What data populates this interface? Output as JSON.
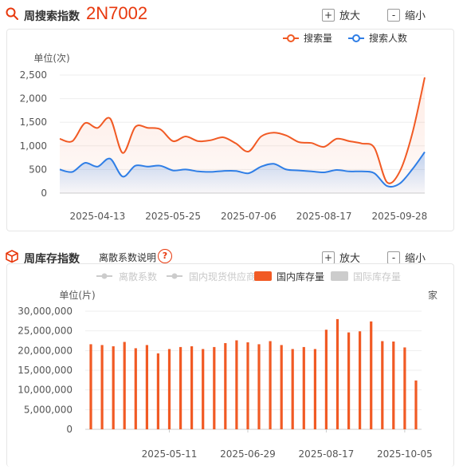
{
  "search_index": {
    "title": "周搜索指数",
    "part_code": "2N7002",
    "zoom_in_label": "放大",
    "zoom_out_label": "缩小",
    "colors": {
      "search_volume": "#f15a24",
      "searchers": "#2f7ee6"
    }
  },
  "inventory_index": {
    "title": "周库存指数",
    "explain_label": "离散系数说明",
    "help_symbol": "?",
    "zoom_in_label": "放大",
    "zoom_out_label": "缩小",
    "colors": {
      "domestic_inventory": "#f15a24",
      "inactive": "#cccccc"
    }
  },
  "chart_data": [
    {
      "type": "area",
      "ylabel": "单位(次)",
      "legend_position": "top-right",
      "ylim": [
        0,
        2500
      ],
      "yticks": [
        "0",
        "500",
        "1,000",
        "1,500",
        "2,000",
        "2,500"
      ],
      "xtick_labels": [
        "2025-04-13",
        "2025-05-25",
        "2025-07-06",
        "2025-08-17",
        "2025-09-28"
      ],
      "x": [
        "2025-03-23",
        "2025-03-30",
        "2025-04-06",
        "2025-04-13",
        "2025-04-20",
        "2025-04-27",
        "2025-05-04",
        "2025-05-11",
        "2025-05-18",
        "2025-05-25",
        "2025-06-01",
        "2025-06-08",
        "2025-06-15",
        "2025-06-22",
        "2025-06-29",
        "2025-07-06",
        "2025-07-13",
        "2025-07-20",
        "2025-07-27",
        "2025-08-03",
        "2025-08-10",
        "2025-08-17",
        "2025-08-24",
        "2025-08-31",
        "2025-09-07",
        "2025-09-14",
        "2025-09-21",
        "2025-09-28",
        "2025-10-05",
        "2025-10-12"
      ],
      "series": [
        {
          "name": "搜索量",
          "values": [
            1150,
            1100,
            1480,
            1380,
            1580,
            850,
            1400,
            1380,
            1350,
            1100,
            1200,
            1100,
            1120,
            1180,
            1050,
            880,
            1200,
            1280,
            1220,
            1080,
            1060,
            980,
            1150,
            1100,
            1050,
            960,
            230,
            450,
            1250,
            2450
          ]
        },
        {
          "name": "搜索人数",
          "values": [
            500,
            450,
            640,
            560,
            730,
            350,
            580,
            560,
            580,
            480,
            500,
            460,
            450,
            470,
            470,
            420,
            560,
            620,
            500,
            480,
            460,
            440,
            490,
            460,
            460,
            420,
            150,
            200,
            500,
            870
          ]
        }
      ]
    },
    {
      "type": "bar",
      "ylabel": "单位(片)",
      "right_label": "家",
      "legend_position": "top",
      "ylim": [
        0,
        30000000
      ],
      "yticks": [
        "0",
        "5,000,000",
        "10,000,000",
        "15,000,000",
        "20,000,000",
        "25,000,000",
        "30,000,000"
      ],
      "xtick_labels": [
        "2025-05-11",
        "2025-06-29",
        "2025-08-17",
        "2025-10-05"
      ],
      "legend": [
        {
          "name": "离散系数",
          "active": false
        },
        {
          "name": "国内现货供应商",
          "active": false
        },
        {
          "name": "国内库存量",
          "active": true
        },
        {
          "name": "国际库存量",
          "active": false
        }
      ],
      "series": [
        {
          "name": "国内库存量",
          "values": [
            21600000,
            21400000,
            21100000,
            22200000,
            20600000,
            21400000,
            19300000,
            20400000,
            20900000,
            21100000,
            20400000,
            20900000,
            21900000,
            22600000,
            22100000,
            21600000,
            22400000,
            21400000,
            20400000,
            20900000,
            20400000,
            25300000,
            28000000,
            24600000,
            24900000,
            27400000,
            22400000,
            22300000,
            20800000,
            12400000
          ]
        }
      ]
    }
  ]
}
